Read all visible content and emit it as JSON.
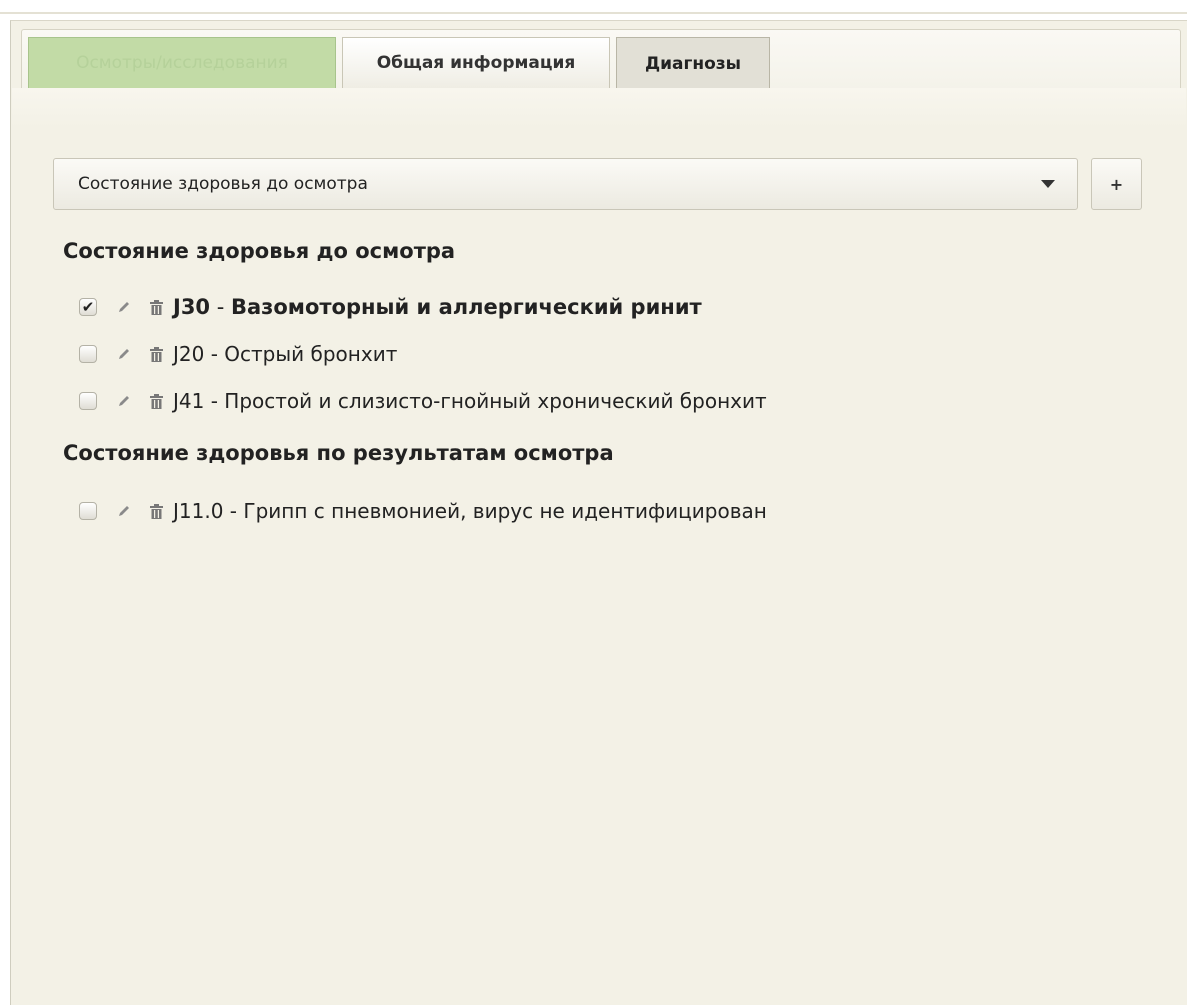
{
  "tabs": [
    {
      "label": "Осмотры/исследования"
    },
    {
      "label": "Общая информация"
    },
    {
      "label": "Диагнозы"
    }
  ],
  "select": {
    "value": "Состояние здоровья до осмотра"
  },
  "add_button": {
    "label": "+"
  },
  "groups": [
    {
      "title": "Состояние здоровья до осмотра",
      "items": [
        {
          "code": "J30",
          "name": "Вазомоторный и аллергический ринит",
          "checked": true,
          "main": true
        },
        {
          "code": "J20",
          "name": "Острый бронхит",
          "checked": false,
          "main": false
        },
        {
          "code": "J41",
          "name": "Простой и слизисто-гнойный хронический бронхит",
          "checked": false,
          "main": false
        }
      ]
    },
    {
      "title": "Состояние здоровья по результатам осмотра",
      "items": [
        {
          "code": "J11.0",
          "name": "Грипп с пневмонией, вирус не идентифицирован",
          "checked": false,
          "main": false
        }
      ]
    }
  ],
  "icons": {
    "pencil": "pencil-icon",
    "trash": "trash-icon",
    "check": "check-icon"
  },
  "colors": {
    "active_tab": "#c2dba6",
    "background": "#f3f1e6"
  }
}
